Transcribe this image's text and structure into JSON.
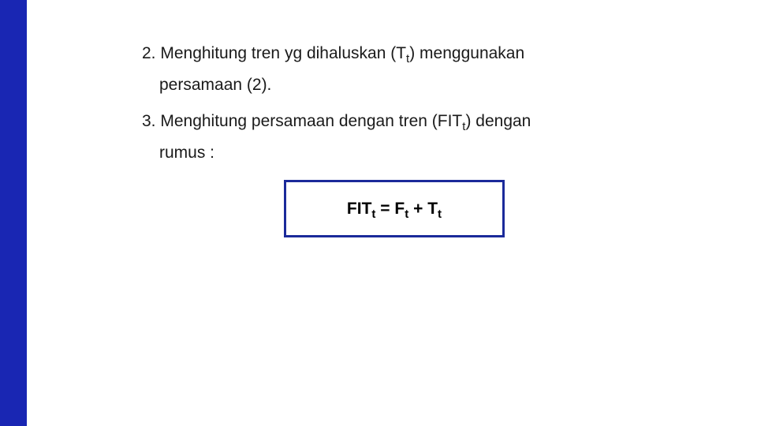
{
  "item2": {
    "line1_pre": "2. Menghitung tren yg dihaluskan (T",
    "line1_sub": "t",
    "line1_post": ") menggunakan",
    "line2": "persamaan (2)."
  },
  "item3": {
    "line1_pre": "3. Menghitung persamaan dengan tren (FIT",
    "line1_sub": "t",
    "line1_post": ") dengan",
    "line2": "rumus :"
  },
  "formula": {
    "p1": "FIT",
    "s1": "t",
    "p2": " = F",
    "s2": "t",
    "p3": " + T",
    "s3": "t"
  }
}
